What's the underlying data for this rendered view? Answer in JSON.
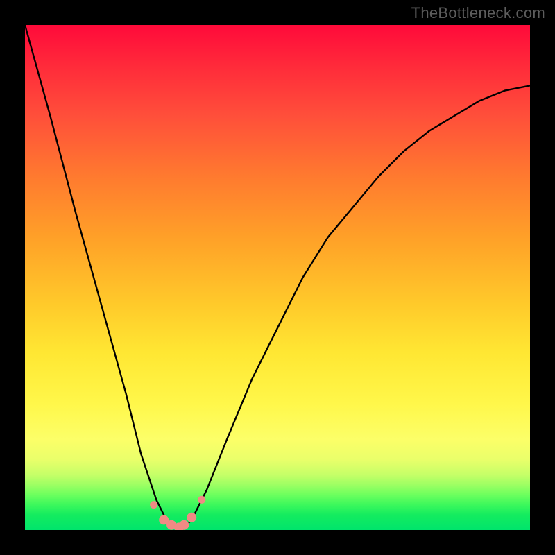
{
  "watermark": "TheBottleneck.com",
  "chart_data": {
    "type": "line",
    "title": "",
    "xlabel": "",
    "ylabel": "",
    "xlim": [
      0,
      1
    ],
    "ylim": [
      0,
      100
    ],
    "series": [
      {
        "name": "bottleneck-curve",
        "x": [
          0.0,
          0.05,
          0.1,
          0.15,
          0.2,
          0.23,
          0.26,
          0.28,
          0.3,
          0.31,
          0.33,
          0.36,
          0.4,
          0.45,
          0.5,
          0.55,
          0.6,
          0.65,
          0.7,
          0.75,
          0.8,
          0.85,
          0.9,
          0.95,
          1.0
        ],
        "values": [
          100,
          82,
          63,
          45,
          27,
          15,
          6,
          2,
          0,
          0,
          2,
          8,
          18,
          30,
          40,
          50,
          58,
          64,
          70,
          75,
          79,
          82,
          85,
          87,
          88
        ]
      }
    ],
    "markers": {
      "name": "highlight-points",
      "color": "#f08a84",
      "x": [
        0.255,
        0.275,
        0.29,
        0.305,
        0.315,
        0.33,
        0.35
      ],
      "values": [
        5,
        2,
        1,
        0.5,
        1,
        2.5,
        6
      ]
    },
    "gradient_stops": [
      {
        "pos": 0.0,
        "color": "#ff0a3a"
      },
      {
        "pos": 0.3,
        "color": "#ff7a2f"
      },
      {
        "pos": 0.55,
        "color": "#ffc92a"
      },
      {
        "pos": 0.8,
        "color": "#fcff68"
      },
      {
        "pos": 0.93,
        "color": "#6dff5e"
      },
      {
        "pos": 1.0,
        "color": "#00e46c"
      }
    ],
    "valley_x": 0.3
  }
}
